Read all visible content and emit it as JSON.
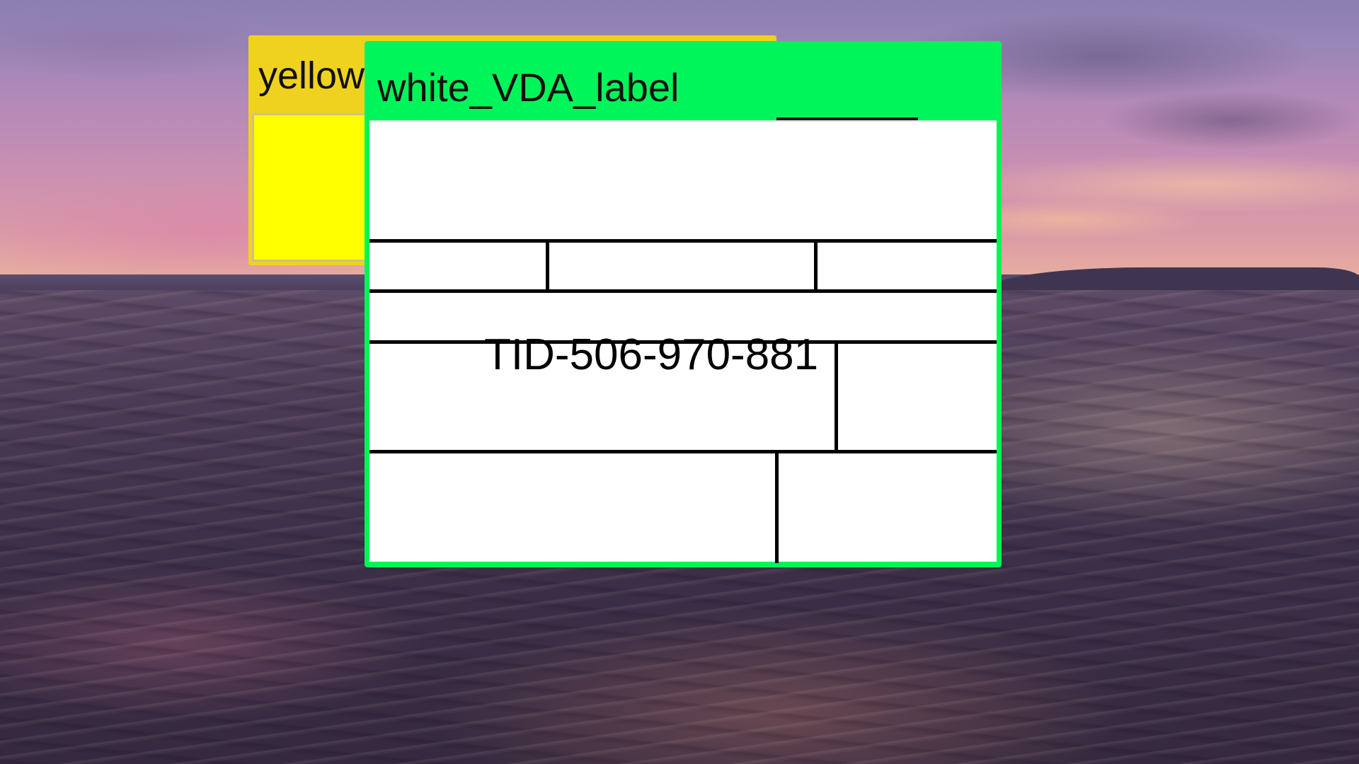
{
  "desktop": {
    "wallpaper": "sunset-over-sea",
    "colors": {
      "sky_top": "#8a7fb0",
      "sky_bottom": "#e7b3a0",
      "sea": "#3c2f48"
    }
  },
  "windows": {
    "yellow": {
      "title": "yellow",
      "color": "#efd21f",
      "body_color": "#ffff00"
    },
    "green": {
      "title": "white_VDA_label",
      "color": "#00f55a",
      "label": {
        "tid": "TID-506-970-881",
        "background": "#ffffff"
      }
    }
  }
}
